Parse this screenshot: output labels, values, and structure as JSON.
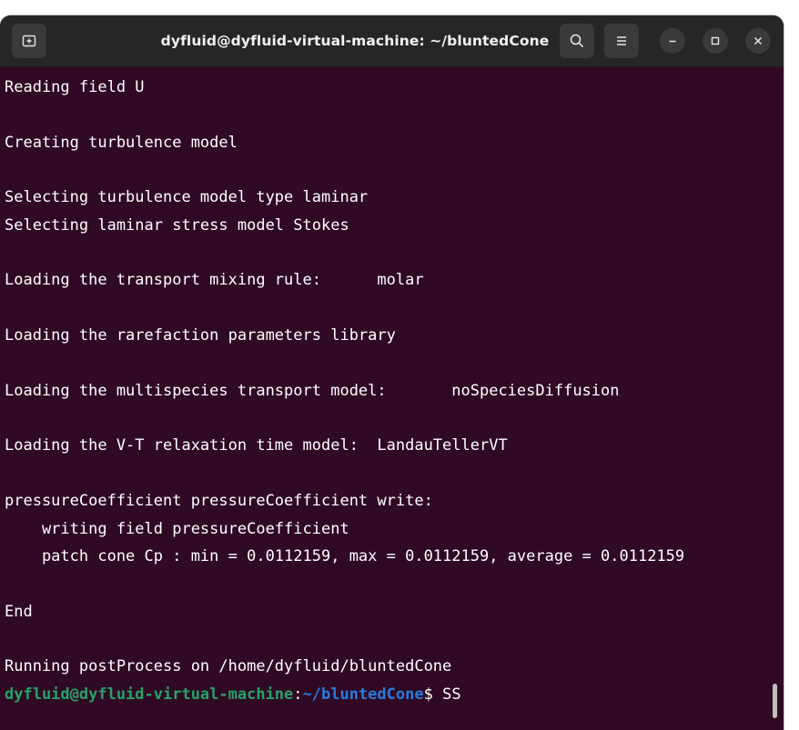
{
  "window": {
    "title": "dyfluid@dyfluid-virtual-machine: ~/bluntedCone"
  },
  "titlebar": {
    "new_tab_icon": "new-tab-icon",
    "search_icon": "search-icon",
    "menu_icon": "hamburger-menu-icon",
    "minimize_icon": "minimize-icon",
    "maximize_icon": "maximize-icon",
    "close_icon": "close-icon"
  },
  "terminal": {
    "lines": [
      "Reading field U",
      "",
      "Creating turbulence model",
      "",
      "Selecting turbulence model type laminar",
      "Selecting laminar stress model Stokes",
      "",
      "Loading the transport mixing rule:      molar",
      "",
      "Loading the rarefaction parameters library",
      "",
      "Loading the multispecies transport model:       noSpeciesDiffusion",
      "",
      "Loading the V-T relaxation time model:  LandauTellerVT",
      "",
      "pressureCoefficient pressureCoefficient write:",
      "    writing field pressureCoefficient",
      "    patch cone Cp : min = 0.0112159, max = 0.0112159, average = 0.0112159",
      "",
      "End",
      "",
      "Running postProcess on /home/dyfluid/bluntedCone"
    ],
    "prompt": {
      "user_host": "dyfluid@dyfluid-virtual-machine",
      "separator": ":",
      "path": "~/bluntedCone",
      "dollar": "$ ",
      "input": "SS"
    }
  },
  "colors": {
    "background": "#300a24",
    "titlebar": "#262626",
    "prompt_user": "#26a269",
    "prompt_path": "#2a7bde",
    "text": "#ffffff"
  }
}
